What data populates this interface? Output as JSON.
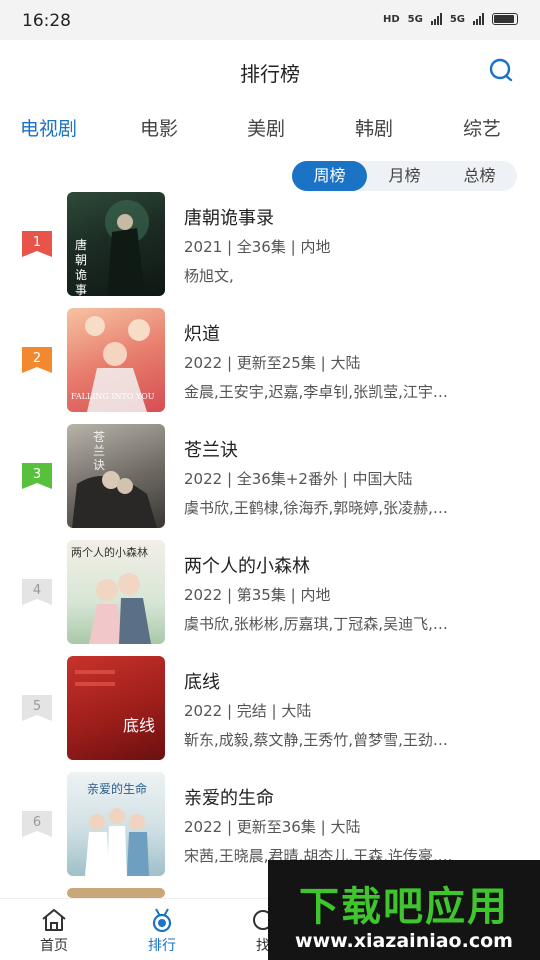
{
  "status_bar": {
    "time": "16:28",
    "network_1": "HD",
    "network_2": "5G",
    "network_3": "5G"
  },
  "header": {
    "title": "排行榜"
  },
  "category_tabs": [
    {
      "label": "电视剧",
      "active": true
    },
    {
      "label": "电影",
      "active": false
    },
    {
      "label": "美剧",
      "active": false
    },
    {
      "label": "韩剧",
      "active": false
    },
    {
      "label": "综艺",
      "active": false
    }
  ],
  "period_tabs": [
    {
      "label": "周榜",
      "active": true
    },
    {
      "label": "月榜",
      "active": false
    },
    {
      "label": "总榜",
      "active": false
    }
  ],
  "rank_colors": {
    "1": "#e8534a",
    "2": "#f3892f",
    "3": "#57c13c",
    "default": "#e4e4e4"
  },
  "items": [
    {
      "rank": "1",
      "title": "唐朝诡事录",
      "meta": "2021 | 全36集 | 内地",
      "cast": "杨旭文,",
      "poster_text": "唐朝诡事录"
    },
    {
      "rank": "2",
      "title": "炽道",
      "meta": "2022 | 更新至25集 | 大陆",
      "cast": "金晨,王安宇,迟嘉,李卓钊,张凯莹,江宇…",
      "poster_text": "FALLING INTO YOU"
    },
    {
      "rank": "3",
      "title": "苍兰诀",
      "meta": "2022 | 全36集+2番外 | 中国大陆",
      "cast": "虞书欣,王鹤棣,徐海乔,郭晓婷,张凌赫,…",
      "poster_text": "苍兰诀"
    },
    {
      "rank": "4",
      "title": "两个人的小森林",
      "meta": "2022 | 第35集 | 内地",
      "cast": "虞书欣,张彬彬,厉嘉琪,丁冠森,吴迪飞,…",
      "poster_text": "两个人的小森林"
    },
    {
      "rank": "5",
      "title": "底线",
      "meta": "2022 | 完结 | 大陆",
      "cast": "靳东,成毅,蔡文静,王秀竹,曾梦雪,王劲…",
      "poster_text": "底线"
    },
    {
      "rank": "6",
      "title": "亲爱的生命",
      "meta": "2022 | 更新至36集 | 大陆",
      "cast": "宋茜,王晓晨,君晴,胡杏儿,王森,许传豪,…",
      "poster_text": "亲爱的生命"
    }
  ],
  "bottom_nav": [
    {
      "label": "首页",
      "icon": "home-icon",
      "active": false
    },
    {
      "label": "排行",
      "icon": "medal-icon",
      "active": true
    },
    {
      "label": "找",
      "icon": "find-icon",
      "active": false
    }
  ],
  "watermark": {
    "title": "下载吧应用",
    "url": "www.xiazainiao.com"
  }
}
